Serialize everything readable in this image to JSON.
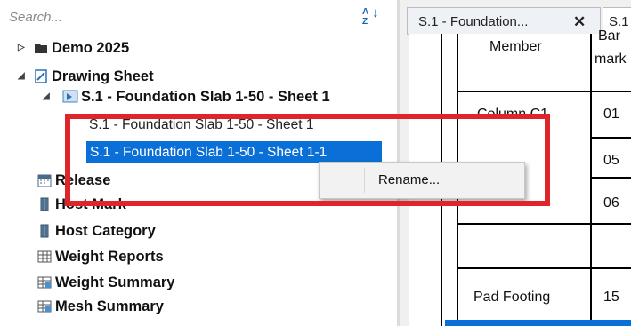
{
  "search": {
    "placeholder": "Search...",
    "sort_top": "A",
    "sort_bottom": "Z"
  },
  "tree": {
    "demo": "Demo 2025",
    "drawing_sheet": "Drawing Sheet",
    "sheet_parent": "S.1 - Foundation Slab 1-50 - Sheet 1",
    "sheet_child_1": "S.1 - Foundation Slab 1-50 - Sheet 1",
    "sheet_child_2": "S.1 - Foundation Slab 1-50 - Sheet 1-1",
    "release": "Release",
    "host_mark": "Host Mark",
    "host_category": "Host Category",
    "weight_reports": "Weight Reports",
    "weight_summary": "Weight Summary",
    "mesh_summary": "Mesh Summary"
  },
  "context_menu": {
    "rename": "Rename..."
  },
  "tabs": {
    "tab1": "S.1 - Foundation...",
    "tab2": "S.1"
  },
  "schedule": {
    "header_member": "Member",
    "header_bar_1": "Bar",
    "header_bar_2": "mark",
    "rows": [
      {
        "member": "Column C1",
        "mark": "01"
      },
      {
        "member": "",
        "mark": "05"
      },
      {
        "member": "",
        "mark": "06"
      },
      {
        "member": "",
        "mark": ""
      },
      {
        "member": "Pad Footing",
        "mark": "15"
      }
    ]
  },
  "colors": {
    "selection": "#0a6fd6",
    "highlight_box": "#e0252a"
  }
}
